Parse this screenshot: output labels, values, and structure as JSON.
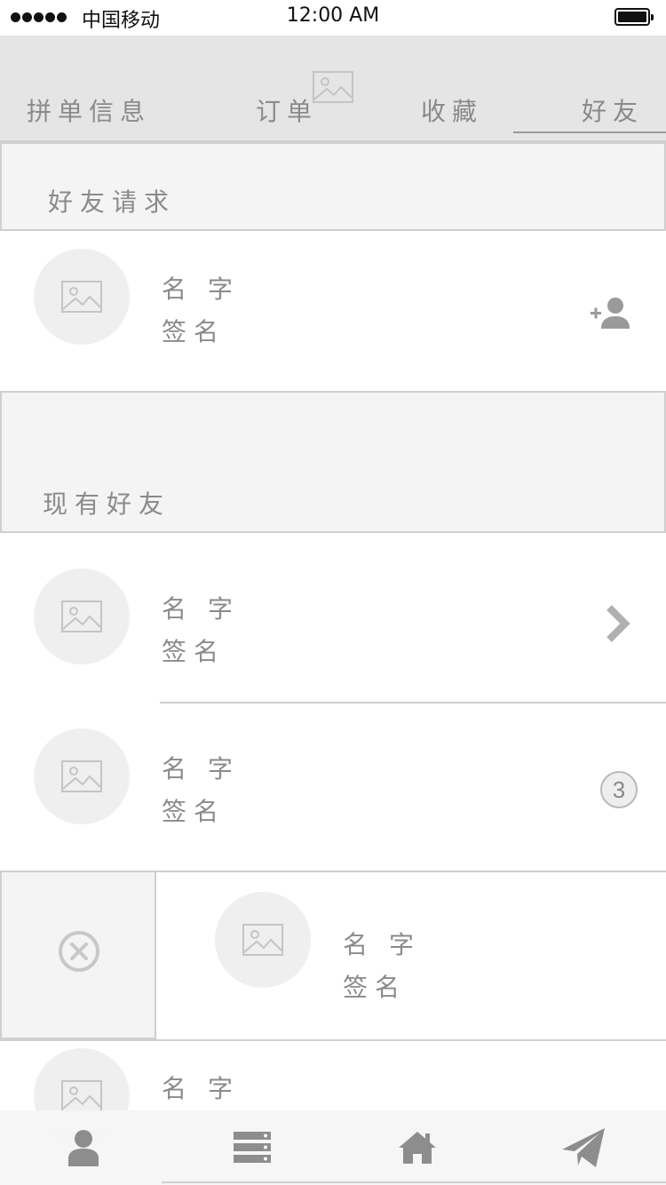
{
  "status_bar": {
    "carrier": "中国移动",
    "time": "12:00 AM",
    "signal_icon": "signal-dots-icon",
    "battery_icon": "battery-full-icon"
  },
  "top_tabs": {
    "items": [
      {
        "label": "拼单信息"
      },
      {
        "label": "订单"
      },
      {
        "label": "收藏"
      },
      {
        "label": "好友",
        "selected": true
      }
    ]
  },
  "friend_requests": {
    "title": "好友请求",
    "items": [
      {
        "name": "名字",
        "signature": "签名",
        "action_icon": "add-friend-icon"
      }
    ]
  },
  "current_friends": {
    "title": "现有好友",
    "items": [
      {
        "name": "名字",
        "signature": "签名",
        "action_icon": "chevron-right-icon"
      },
      {
        "name": "名字",
        "signature": "签名",
        "badge": "3"
      },
      {
        "name": "名字",
        "signature": "签名",
        "delete_icon": "delete-circle-icon"
      },
      {
        "name": "名字"
      }
    ]
  },
  "bottom_tabs": {
    "items": [
      {
        "icon": "user-icon"
      },
      {
        "icon": "list-icon"
      },
      {
        "icon": "home-icon"
      },
      {
        "icon": "paper-plane-icon"
      }
    ]
  },
  "colors": {
    "header_bg": "#e5e5e5",
    "section_bg": "#f4f4f4",
    "text": "#8a8a8a",
    "icon": "#9a9a9a",
    "avatar_bg": "#efefef"
  }
}
